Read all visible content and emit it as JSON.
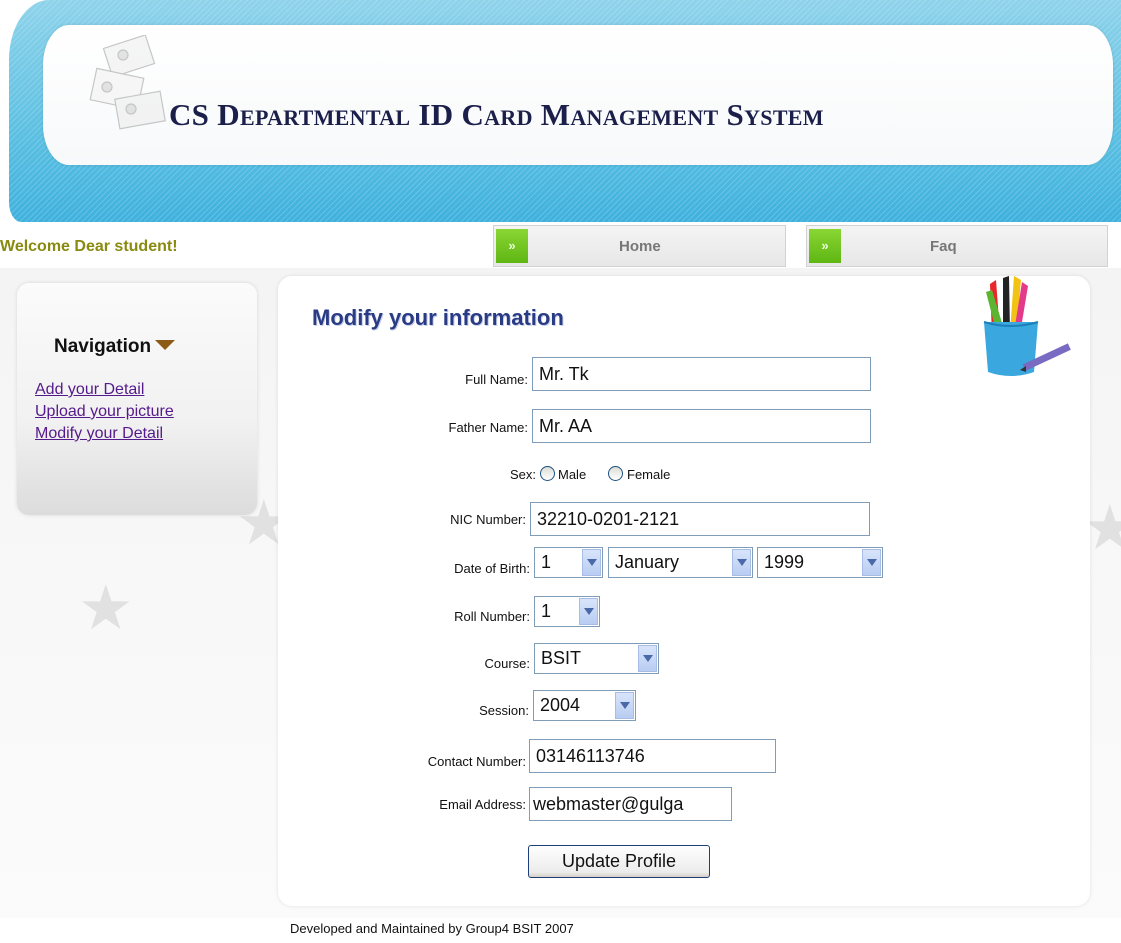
{
  "header": {
    "title": "CS Departmental ID Card Management System"
  },
  "menubar": {
    "welcome": "Welcome Dear student!",
    "items": [
      {
        "label": "Home"
      },
      {
        "label": "Faq"
      }
    ]
  },
  "sidebar": {
    "title": "Navigation",
    "links": [
      {
        "label": "Add your Detail"
      },
      {
        "label": "Upload your picture"
      },
      {
        "label": "Modify your Detail"
      }
    ]
  },
  "main": {
    "title": "Modify your information",
    "form": {
      "full_name": {
        "label": "Full Name:",
        "value": "Mr. Tk"
      },
      "father_name": {
        "label": "Father Name:",
        "value": "Mr. AA"
      },
      "sex": {
        "label": "Sex:",
        "options": [
          "Male",
          "Female"
        ]
      },
      "nic": {
        "label": "NIC Number:",
        "value": "32210-0201-2121"
      },
      "dob": {
        "label": "Date of Birth:",
        "day": "1",
        "month": "January",
        "year": "1999"
      },
      "roll": {
        "label": "Roll Number:",
        "value": "1"
      },
      "course": {
        "label": "Course:",
        "value": "BSIT"
      },
      "session": {
        "label": "Session:",
        "value": "2004"
      },
      "contact": {
        "label": "Contact Number:",
        "value": "03146113746"
      },
      "email": {
        "label": "Email Address:",
        "value": "webmaster@gulga"
      },
      "submit_label": "Update Profile"
    }
  },
  "footer": {
    "text": "Developed and Maintained by Group4 BSIT 2007"
  },
  "colors": {
    "header_blue": "#5cc0e2",
    "menu_green": "#6cc220",
    "title_blue": "#2a3b86",
    "welcome_olive": "#8a8a10",
    "link_purple": "#551a8b"
  }
}
